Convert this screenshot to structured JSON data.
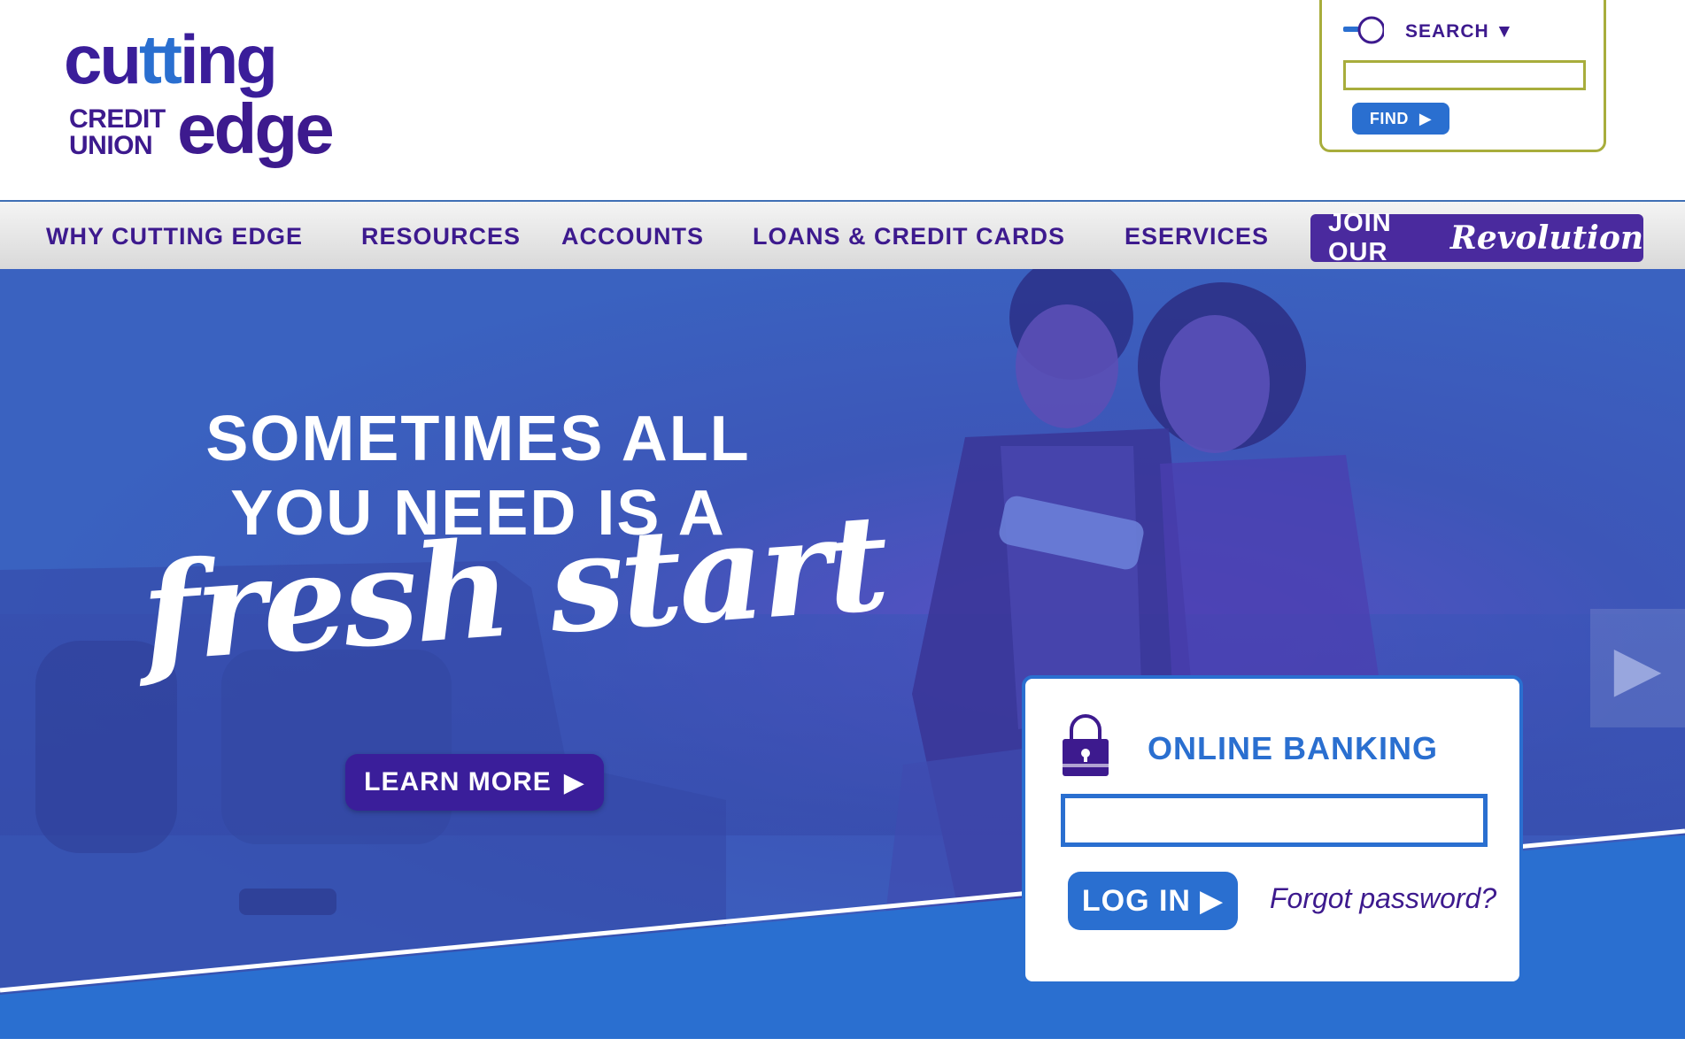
{
  "logo": {
    "word1_part_a": "cu",
    "word1_part_b": "tt",
    "word1_part_c": "ing",
    "word2": "edge",
    "line1": "CREDIT",
    "line2": "UNION"
  },
  "search": {
    "label": "SEARCH ▼",
    "input_value": "",
    "find_label": "FIND",
    "find_arrow": "▶"
  },
  "nav": {
    "items": [
      {
        "label": "WHY CUTTING EDGE"
      },
      {
        "label": "RESOURCES"
      },
      {
        "label": "ACCOUNTS"
      },
      {
        "label": "LOANS & CREDIT CARDS"
      },
      {
        "label": "ESERVICES"
      }
    ],
    "join_label": "JOIN OUR",
    "join_script": "Revolution"
  },
  "hero": {
    "headline_line1": "SOMETIMES ALL",
    "headline_line2": "YOU NEED IS A",
    "script_text": "fresh start",
    "learn_more_label": "LEARN MORE",
    "learn_more_arrow": "▶",
    "next_arrow": "▶"
  },
  "login": {
    "title": "ONLINE BANKING",
    "input_value": "",
    "login_label": "LOG IN",
    "login_arrow": "▶",
    "forgot_label": "Forgot password?"
  },
  "colors": {
    "brand_purple": "#3d1a8e",
    "brand_blue": "#2a6fd0",
    "search_border": "#a8ad3c"
  }
}
